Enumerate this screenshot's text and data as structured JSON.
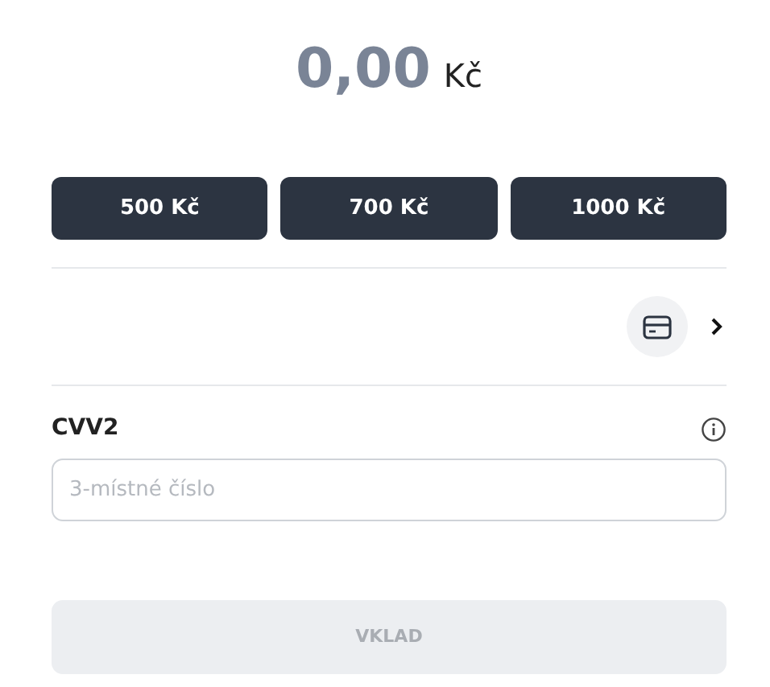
{
  "amount": {
    "value": "0,00",
    "currency": "Kč"
  },
  "presets": [
    {
      "label": "500 Kč"
    },
    {
      "label": "700 Kč"
    },
    {
      "label": "1000 Kč"
    }
  ],
  "cvv": {
    "label": "CVV2",
    "placeholder": "3-místné číslo"
  },
  "submit": {
    "label": "VKLAD",
    "disabled": true
  }
}
